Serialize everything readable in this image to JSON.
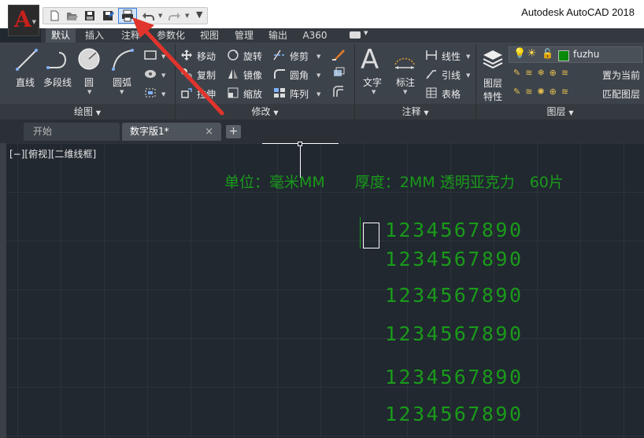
{
  "app": {
    "title": "Autodesk AutoCAD 2018",
    "logo_letter": "A"
  },
  "quick_access": {
    "icons": [
      "new-icon",
      "open-icon",
      "save-icon",
      "save-as-icon",
      "plot-icon",
      "undo-icon",
      "redo-icon",
      "customize-icon"
    ]
  },
  "ribbon_tabs": [
    "默认",
    "插入",
    "注释",
    "参数化",
    "视图",
    "管理",
    "输出",
    "A360"
  ],
  "panels": {
    "draw": {
      "title": "绘图",
      "tools": [
        "直线",
        "多段线",
        "圆",
        "圆弧"
      ]
    },
    "modify": {
      "title": "修改",
      "tools": [
        "移动",
        "旋转",
        "修剪",
        "复制",
        "镜像",
        "圆角",
        "拉伸",
        "缩放",
        "阵列"
      ]
    },
    "annotation": {
      "title": "注释",
      "tools": [
        "文字",
        "标注",
        "线性",
        "引线",
        "表格"
      ]
    },
    "layers": {
      "title": "图层",
      "properties_label": "图层\n特性",
      "properties_line1": "图层",
      "properties_line2": "特性",
      "current_layer": "fuzhu",
      "layer_color": "#0a8a0a",
      "set_current": "置为当前",
      "match_layer": "匹配图层"
    }
  },
  "doc_tabs": {
    "start": "开始",
    "active": "数字版1*",
    "close": "×",
    "add": "+"
  },
  "viewport_label": "[−][俯视][二维线框]",
  "drawing": {
    "header_text": "单位：毫米MM　　厚度：2MM 透明亚克力　60片",
    "digit_rows": [
      "1234567890",
      "1234567890",
      "1234567890",
      "1234567890",
      "1234567890",
      "1234567890"
    ],
    "text_color": "#1a9a1a"
  },
  "colors": {
    "accent_red": "#e0342c",
    "ribbon_bg": "#3d434b",
    "canvas_bg": "#212830"
  }
}
